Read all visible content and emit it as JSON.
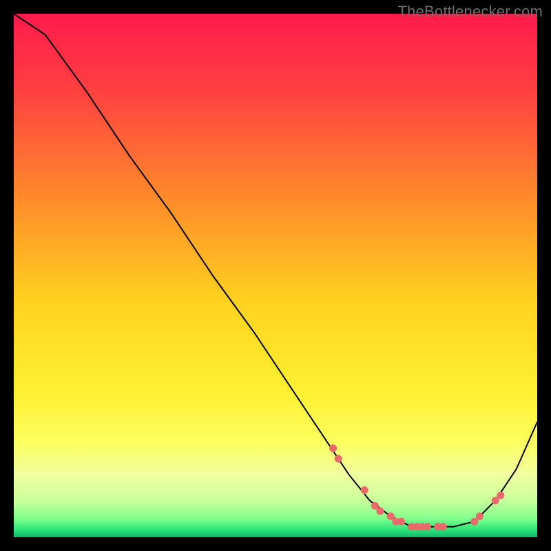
{
  "watermark": "TheBottlenecker.com",
  "colors": {
    "frame": "#000000",
    "text": "#6e6e6e",
    "curve": "#000000",
    "marker_fill": "#e86a6a",
    "marker_stroke": "#e86a6a"
  },
  "gradient_stops": [
    {
      "offset": 0.0,
      "color": "#ff1a4c"
    },
    {
      "offset": 0.15,
      "color": "#ff4141"
    },
    {
      "offset": 0.35,
      "color": "#ff8a2a"
    },
    {
      "offset": 0.55,
      "color": "#ffd21f"
    },
    {
      "offset": 0.72,
      "color": "#fef030"
    },
    {
      "offset": 0.82,
      "color": "#fcff60"
    },
    {
      "offset": 0.88,
      "color": "#f1ffa0"
    },
    {
      "offset": 0.93,
      "color": "#c9ff9a"
    },
    {
      "offset": 0.965,
      "color": "#7fff8c"
    },
    {
      "offset": 0.985,
      "color": "#2fe47a"
    },
    {
      "offset": 1.0,
      "color": "#0fb96b"
    }
  ],
  "chart_data": {
    "type": "line",
    "title": "",
    "xlabel": "",
    "ylabel": "",
    "xlim": [
      0,
      100
    ],
    "ylim": [
      0,
      100
    ],
    "series": [
      {
        "name": "bottleneck-curve",
        "x": [
          0,
          6,
          14,
          22,
          30,
          38,
          46,
          54,
          60,
          64,
          68,
          72,
          76,
          80,
          84,
          88,
          92,
          96,
          100
        ],
        "y": [
          100,
          96,
          85,
          73,
          62,
          50,
          39,
          27,
          18,
          12,
          7,
          4,
          2,
          2,
          2,
          3,
          7,
          13,
          22
        ]
      }
    ],
    "markers": {
      "name": "highlight-points",
      "x": [
        61,
        62,
        67,
        69,
        70,
        72,
        73,
        74,
        76,
        77,
        78,
        79,
        81,
        82,
        88,
        89,
        92,
        93
      ],
      "y": [
        17,
        15,
        9,
        6,
        5,
        4,
        3,
        3,
        2,
        2,
        2,
        2,
        2,
        2,
        3,
        4,
        7,
        8
      ]
    }
  }
}
